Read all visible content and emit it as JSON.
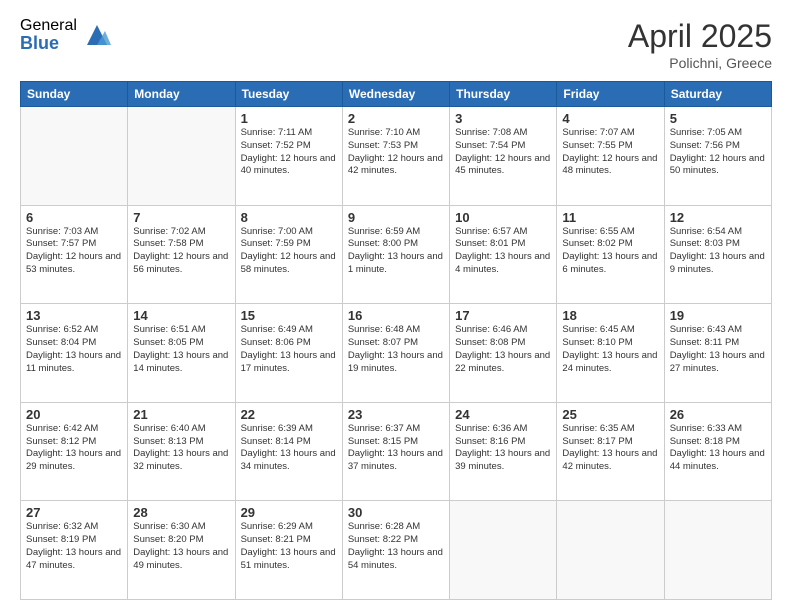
{
  "logo": {
    "general": "General",
    "blue": "Blue"
  },
  "title": "April 2025",
  "location": "Polichni, Greece",
  "days_header": [
    "Sunday",
    "Monday",
    "Tuesday",
    "Wednesday",
    "Thursday",
    "Friday",
    "Saturday"
  ],
  "weeks": [
    [
      {
        "day": "",
        "info": ""
      },
      {
        "day": "",
        "info": ""
      },
      {
        "day": "1",
        "info": "Sunrise: 7:11 AM\nSunset: 7:52 PM\nDaylight: 12 hours and 40 minutes."
      },
      {
        "day": "2",
        "info": "Sunrise: 7:10 AM\nSunset: 7:53 PM\nDaylight: 12 hours and 42 minutes."
      },
      {
        "day": "3",
        "info": "Sunrise: 7:08 AM\nSunset: 7:54 PM\nDaylight: 12 hours and 45 minutes."
      },
      {
        "day": "4",
        "info": "Sunrise: 7:07 AM\nSunset: 7:55 PM\nDaylight: 12 hours and 48 minutes."
      },
      {
        "day": "5",
        "info": "Sunrise: 7:05 AM\nSunset: 7:56 PM\nDaylight: 12 hours and 50 minutes."
      }
    ],
    [
      {
        "day": "6",
        "info": "Sunrise: 7:03 AM\nSunset: 7:57 PM\nDaylight: 12 hours and 53 minutes."
      },
      {
        "day": "7",
        "info": "Sunrise: 7:02 AM\nSunset: 7:58 PM\nDaylight: 12 hours and 56 minutes."
      },
      {
        "day": "8",
        "info": "Sunrise: 7:00 AM\nSunset: 7:59 PM\nDaylight: 12 hours and 58 minutes."
      },
      {
        "day": "9",
        "info": "Sunrise: 6:59 AM\nSunset: 8:00 PM\nDaylight: 13 hours and 1 minute."
      },
      {
        "day": "10",
        "info": "Sunrise: 6:57 AM\nSunset: 8:01 PM\nDaylight: 13 hours and 4 minutes."
      },
      {
        "day": "11",
        "info": "Sunrise: 6:55 AM\nSunset: 8:02 PM\nDaylight: 13 hours and 6 minutes."
      },
      {
        "day": "12",
        "info": "Sunrise: 6:54 AM\nSunset: 8:03 PM\nDaylight: 13 hours and 9 minutes."
      }
    ],
    [
      {
        "day": "13",
        "info": "Sunrise: 6:52 AM\nSunset: 8:04 PM\nDaylight: 13 hours and 11 minutes."
      },
      {
        "day": "14",
        "info": "Sunrise: 6:51 AM\nSunset: 8:05 PM\nDaylight: 13 hours and 14 minutes."
      },
      {
        "day": "15",
        "info": "Sunrise: 6:49 AM\nSunset: 8:06 PM\nDaylight: 13 hours and 17 minutes."
      },
      {
        "day": "16",
        "info": "Sunrise: 6:48 AM\nSunset: 8:07 PM\nDaylight: 13 hours and 19 minutes."
      },
      {
        "day": "17",
        "info": "Sunrise: 6:46 AM\nSunset: 8:08 PM\nDaylight: 13 hours and 22 minutes."
      },
      {
        "day": "18",
        "info": "Sunrise: 6:45 AM\nSunset: 8:10 PM\nDaylight: 13 hours and 24 minutes."
      },
      {
        "day": "19",
        "info": "Sunrise: 6:43 AM\nSunset: 8:11 PM\nDaylight: 13 hours and 27 minutes."
      }
    ],
    [
      {
        "day": "20",
        "info": "Sunrise: 6:42 AM\nSunset: 8:12 PM\nDaylight: 13 hours and 29 minutes."
      },
      {
        "day": "21",
        "info": "Sunrise: 6:40 AM\nSunset: 8:13 PM\nDaylight: 13 hours and 32 minutes."
      },
      {
        "day": "22",
        "info": "Sunrise: 6:39 AM\nSunset: 8:14 PM\nDaylight: 13 hours and 34 minutes."
      },
      {
        "day": "23",
        "info": "Sunrise: 6:37 AM\nSunset: 8:15 PM\nDaylight: 13 hours and 37 minutes."
      },
      {
        "day": "24",
        "info": "Sunrise: 6:36 AM\nSunset: 8:16 PM\nDaylight: 13 hours and 39 minutes."
      },
      {
        "day": "25",
        "info": "Sunrise: 6:35 AM\nSunset: 8:17 PM\nDaylight: 13 hours and 42 minutes."
      },
      {
        "day": "26",
        "info": "Sunrise: 6:33 AM\nSunset: 8:18 PM\nDaylight: 13 hours and 44 minutes."
      }
    ],
    [
      {
        "day": "27",
        "info": "Sunrise: 6:32 AM\nSunset: 8:19 PM\nDaylight: 13 hours and 47 minutes."
      },
      {
        "day": "28",
        "info": "Sunrise: 6:30 AM\nSunset: 8:20 PM\nDaylight: 13 hours and 49 minutes."
      },
      {
        "day": "29",
        "info": "Sunrise: 6:29 AM\nSunset: 8:21 PM\nDaylight: 13 hours and 51 minutes."
      },
      {
        "day": "30",
        "info": "Sunrise: 6:28 AM\nSunset: 8:22 PM\nDaylight: 13 hours and 54 minutes."
      },
      {
        "day": "",
        "info": ""
      },
      {
        "day": "",
        "info": ""
      },
      {
        "day": "",
        "info": ""
      }
    ]
  ]
}
